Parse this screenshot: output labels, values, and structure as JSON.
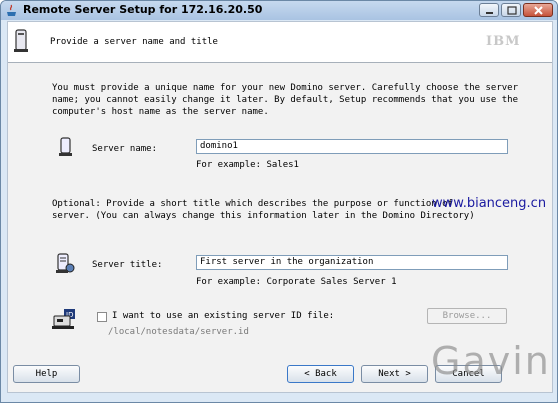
{
  "window": {
    "title": "Remote Server Setup for 172.16.20.50"
  },
  "header": {
    "title": "Provide a server name and title",
    "logo_text": "IBM"
  },
  "intro": {
    "line1": "You must provide a unique name for your new Domino server. Carefully choose the server",
    "line2": "name; you cannot easily change it later. By default, Setup recommends that you use the",
    "line3": "computer's host name as the server name."
  },
  "server_name": {
    "label": "Server name:",
    "value": "domino1",
    "example": "For example: Sales1"
  },
  "optional": {
    "line1": "Optional: Provide a short title which describes the purpose or function of",
    "line2": "server.  (You can always change this information later in the Domino Directory)"
  },
  "server_title": {
    "label": "Server title:",
    "value": "First server in the organization",
    "example": "For example: Corporate Sales Server 1"
  },
  "server_id": {
    "label": "I want to use an existing server ID file:",
    "checked": false,
    "path": "/local/notesdata/server.id",
    "browse_label": "Browse..."
  },
  "buttons": {
    "help": "Help",
    "back": "< Back",
    "next": "Next >",
    "cancel": "Cancel"
  },
  "watermarks": {
    "site": "www.bianceng.cn",
    "author": "Gavin"
  },
  "colors": {
    "titlebar": "#a9c3e2",
    "panel": "#f2f2f2",
    "field_border": "#7f9db9",
    "watermark_site": "#1a1aa0"
  }
}
